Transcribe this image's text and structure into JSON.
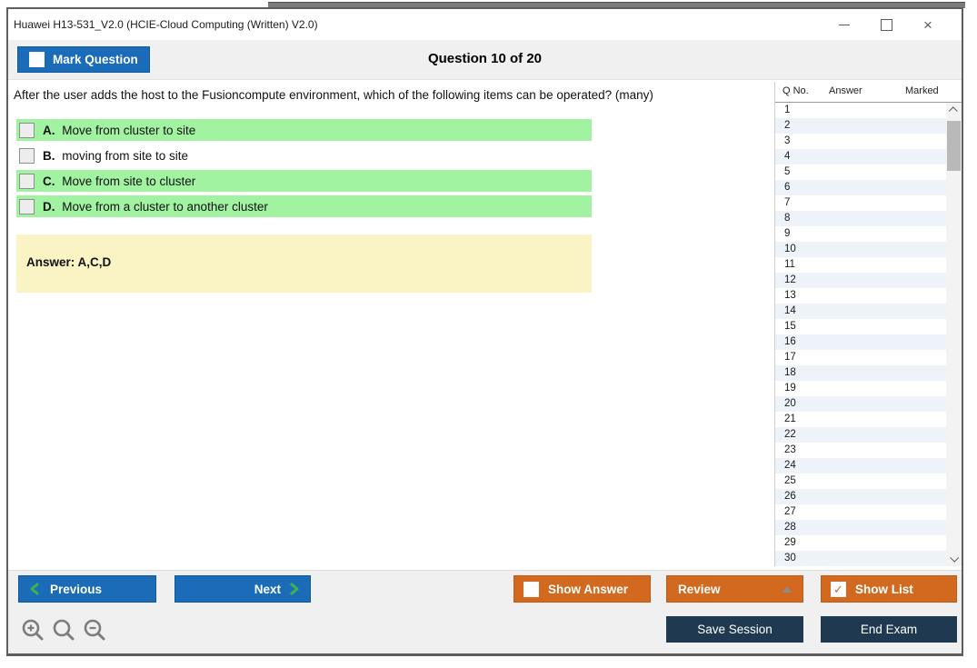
{
  "window": {
    "title": "Huawei H13-531_V2.0 (HCIE-Cloud Computing (Written) V2.0)",
    "icons": {
      "close": "×"
    }
  },
  "toolbar": {
    "mark_question_label": "Mark Question",
    "question_counter": "Question 10 of 20"
  },
  "question": {
    "text": "After the user adds the host to the Fusioncompute environment, which of the following items can be operated? (many)",
    "options": [
      {
        "letter": "A.",
        "text": "Move from cluster to site",
        "highlighted": true,
        "checked": false
      },
      {
        "letter": "B.",
        "text": "moving from site to site",
        "highlighted": false,
        "checked": false
      },
      {
        "letter": "C.",
        "text": "Move from site to cluster",
        "highlighted": true,
        "checked": false
      },
      {
        "letter": "D.",
        "text": "Move from a cluster to another cluster",
        "highlighted": true,
        "checked": false
      }
    ],
    "answer_label": "Answer: A,C,D"
  },
  "question_list": {
    "headers": {
      "q_no": "Q No.",
      "answer": "Answer",
      "marked": "Marked"
    },
    "row_numbers": [
      "1",
      "2",
      "3",
      "4",
      "5",
      "6",
      "7",
      "8",
      "9",
      "10",
      "11",
      "12",
      "13",
      "14",
      "15",
      "16",
      "17",
      "18",
      "19",
      "20",
      "21",
      "22",
      "23",
      "24",
      "25",
      "26",
      "27",
      "28",
      "29",
      "30"
    ]
  },
  "footer": {
    "previous_label": "Previous",
    "next_label": "Next",
    "show_answer_label": "Show Answer",
    "review_label": "Review",
    "show_list_label": "Show List",
    "save_session_label": "Save Session",
    "end_exam_label": "End Exam",
    "show_list_checked": true,
    "show_answer_checked": false,
    "mark_question_checked": false
  },
  "icons": {
    "checkmark": "✓"
  },
  "colors": {
    "button_blue": "#1a6bb8",
    "button_orange": "#d2691e",
    "button_navy": "#1f3a50",
    "option_green": "#a1f3a1",
    "answer_yellow": "#faf3c3",
    "list_alt_row": "#edf3f9",
    "chevron_green": "#3cb44a"
  }
}
